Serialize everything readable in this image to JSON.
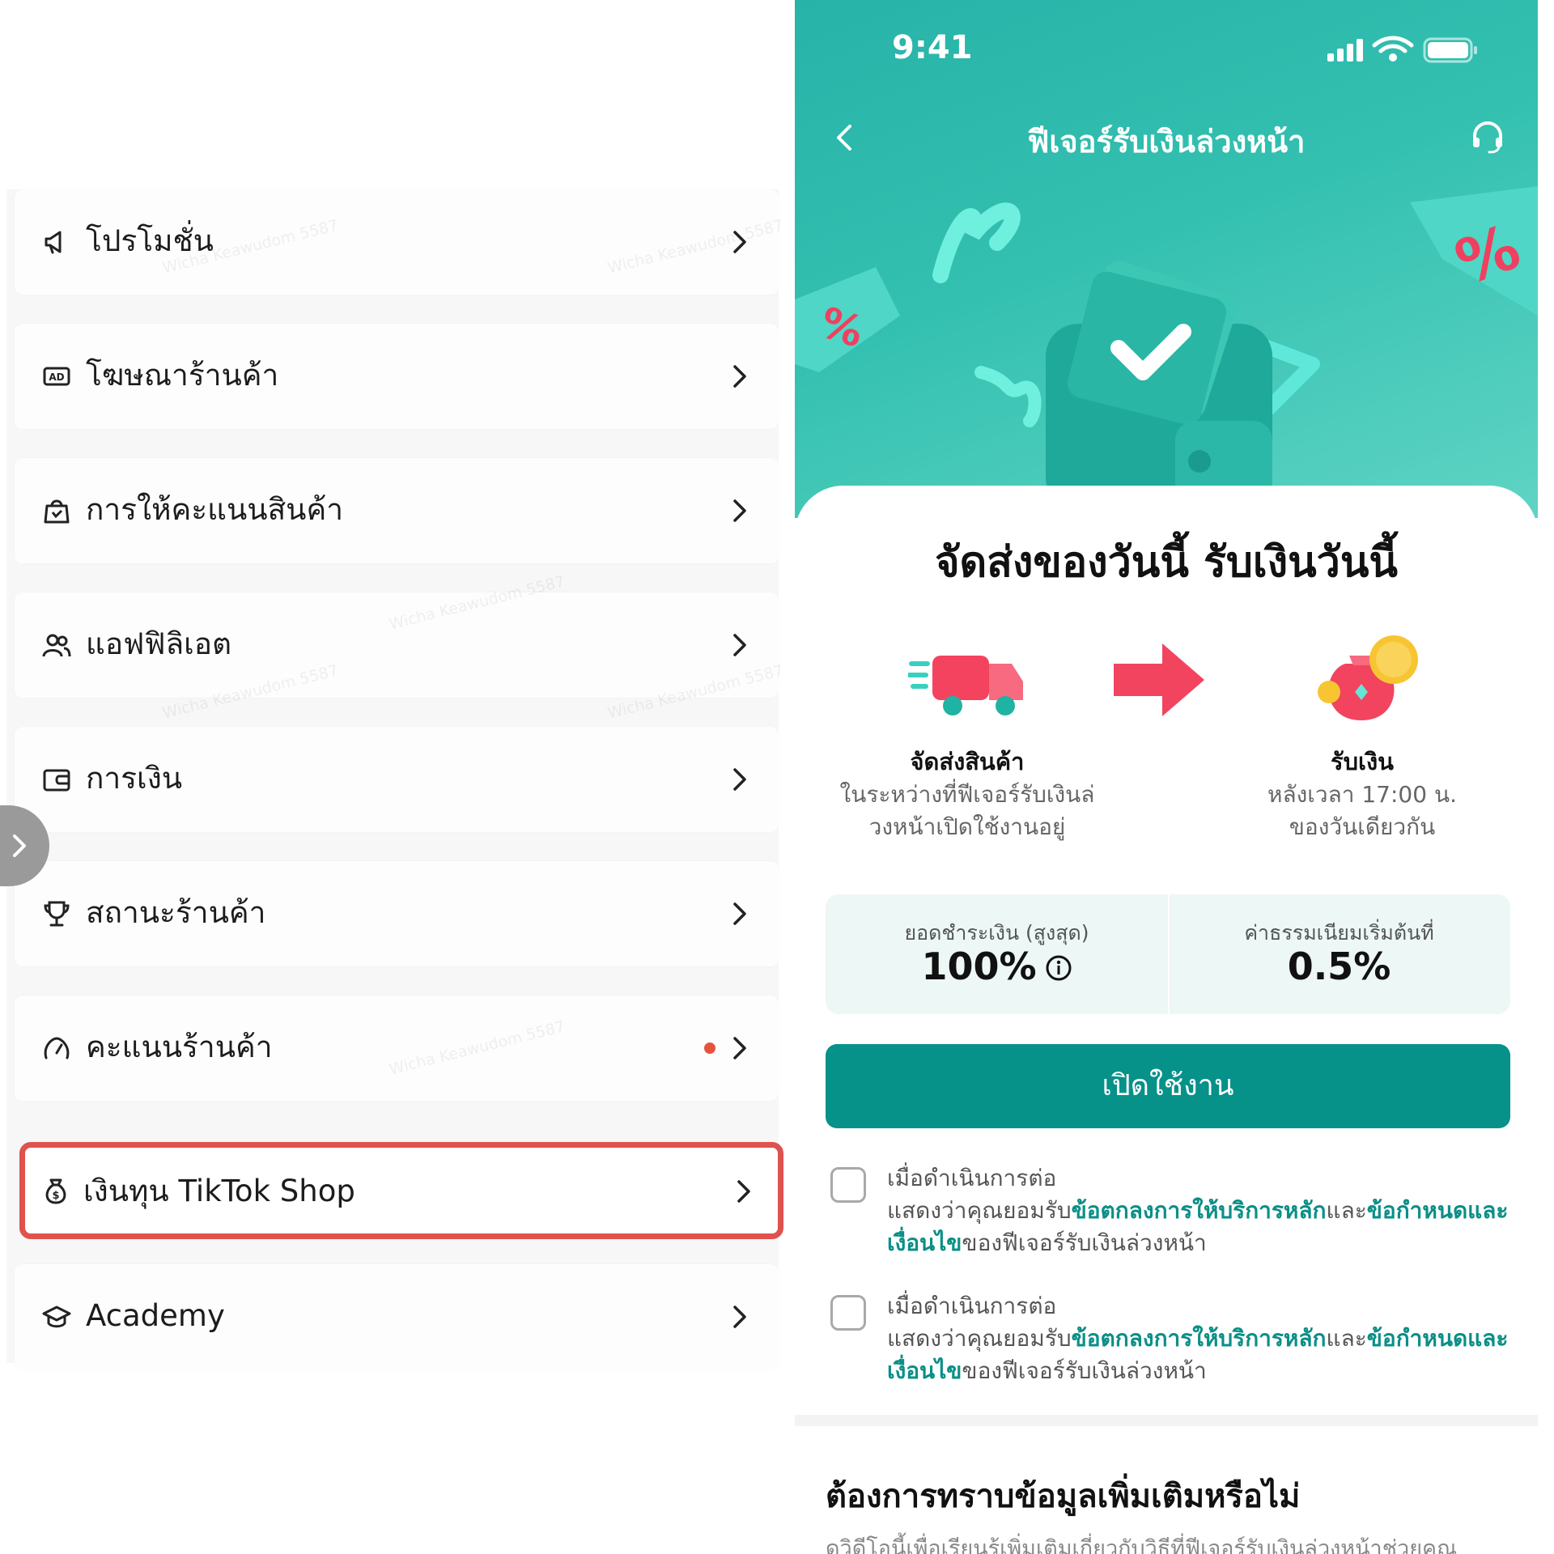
{
  "left": {
    "menu": [
      {
        "id": "promotions",
        "label": "โปรโมชั่น",
        "icon": "megaphone-icon"
      },
      {
        "id": "shop-ads",
        "label": "โฆษณาร้านค้า",
        "icon": "ad-icon"
      },
      {
        "id": "product-ratings",
        "label": "การให้คะแนนสินค้า",
        "icon": "rating-bag-icon"
      },
      {
        "id": "affiliate",
        "label": "แอฟฟิลิเอต",
        "icon": "users-icon"
      },
      {
        "id": "finance",
        "label": "การเงิน",
        "icon": "wallet-icon"
      },
      {
        "id": "shop-status",
        "label": "สถานะร้านค้า",
        "icon": "trophy-icon"
      },
      {
        "id": "shop-score",
        "label": "คะแนนร้านค้า",
        "icon": "gauge-icon",
        "badge": "dot"
      },
      {
        "id": "tiktok-shop-funding",
        "label": "เงินทุน TikTok Shop",
        "icon": "money-bag-icon",
        "highlighted": true
      },
      {
        "id": "academy",
        "label": "Academy",
        "icon": "graduation-cap-icon"
      }
    ],
    "watermark": "Wicha Keawudom 5587",
    "highlight_color": "#e0524e"
  },
  "right": {
    "status_bar": {
      "time": "9:41"
    },
    "nav": {
      "title": "ฟีเจอร์รับเงินล่วงหน้า"
    },
    "headline": "จัดส่งของวันนี้ รับเงินวันนี้",
    "steps": [
      {
        "title": "จัดส่งสินค้า",
        "desc_line1": "ในระหว่างที่ฟีเจอร์รับเงินล่",
        "desc_line2": "วงหน้าเปิดใช้งานอยู่"
      },
      {
        "title": "รับเงิน",
        "desc_line1": "หลังเวลา 17:00 น.",
        "desc_line2": "ของวันเดียวกัน"
      }
    ],
    "stats": [
      {
        "label": "ยอดชำระเงิน (สูงสุด)",
        "value": "100%"
      },
      {
        "label": "ค่าธรรมเนียมเริ่มต้นที่",
        "value": "0.5%"
      }
    ],
    "cta_label": "เปิดใช้งาน",
    "consents": [
      {
        "line1": "เมื่อดำเนินการต่อ",
        "prefix": "แสดงว่าคุณยอมรับ",
        "link1": "ข้อตกลงการให้บริการหลัก",
        "mid": "และ",
        "link2": "ข้อกำหนดและเงื่อนไข",
        "suffix": "ของฟีเจอร์รับเงินล่วงหน้า"
      },
      {
        "line1": "เมื่อดำเนินการต่อ",
        "prefix": "แสดงว่าคุณยอมรับ",
        "link1": "ข้อตกลงการให้บริการหลัก",
        "mid": "และ",
        "link2": "ข้อกำหนดและเงื่อนไข",
        "suffix": "ของฟีเจอร์รับเงินล่วงหน้า"
      }
    ],
    "more": {
      "title": "ต้องการทราบข้อมูลเพิ่มเติมหรือไม่",
      "desc": "ดูวิดีโอนี้เพื่อเรียนรู้เพิ่มเติมเกี่ยวกับวิธีที่ฟีเจอร์รับเงินล่วงหน้าช่วยคุณ"
    },
    "colors": {
      "primary": "#069189",
      "link": "#0a8f87",
      "hero_start": "#27b3a8",
      "hero_end": "#5fd4c4"
    }
  }
}
